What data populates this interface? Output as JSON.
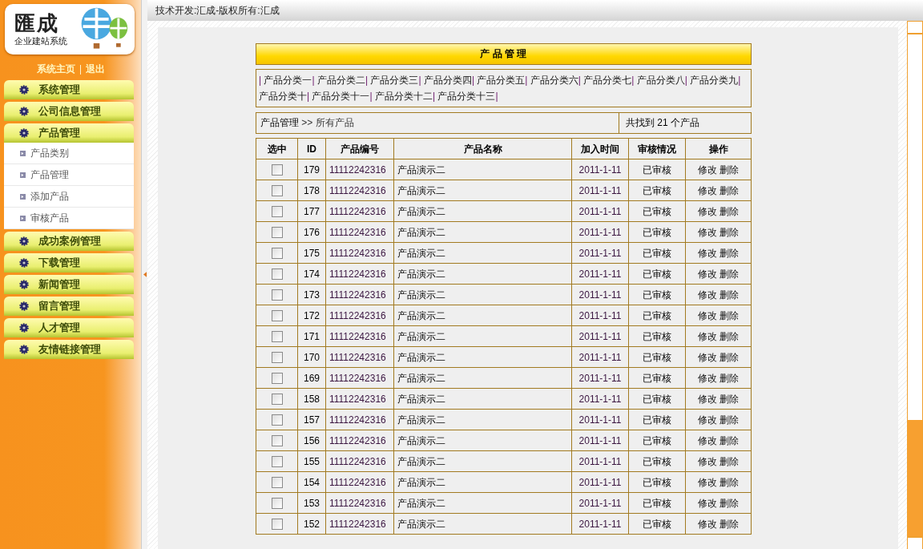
{
  "logo": {
    "title": "匯成",
    "subtitle": "企业建站系统"
  },
  "top_links": [
    "系统主页",
    "退出"
  ],
  "menu": [
    {
      "label": "系统管理",
      "expanded": false
    },
    {
      "label": "公司信息管理",
      "expanded": false
    },
    {
      "label": "产品管理",
      "expanded": true,
      "children": [
        {
          "label": "产品类别"
        },
        {
          "label": "产品管理"
        },
        {
          "label": "添加产品"
        },
        {
          "label": "审核产品"
        }
      ]
    },
    {
      "label": "成功案例管理",
      "expanded": false
    },
    {
      "label": "下载管理",
      "expanded": false
    },
    {
      "label": "新闻管理",
      "expanded": false
    },
    {
      "label": "留言管理",
      "expanded": false
    },
    {
      "label": "人才管理",
      "expanded": false
    },
    {
      "label": "友情链接管理",
      "expanded": false
    }
  ],
  "top_bar": "技术开发:汇成-版权所有:汇成",
  "panel_title": "产 品 管 理",
  "category_separator": "|",
  "categories": [
    "产品分类一",
    "产品分类二",
    "产品分类三",
    "产品分类四",
    "产品分类五",
    "产品分类六",
    "产品分类七",
    "产品分类八",
    "产品分类九",
    "产品分类十",
    "产品分类十一",
    "产品分类十二",
    "产品分类十三"
  ],
  "breadcrumb": {
    "section": "产品管理",
    "current": ">> 所有产品"
  },
  "found": {
    "prefix": "共找到",
    "count": "21",
    "suffix": "个产品"
  },
  "table": {
    "columns": [
      "选中",
      "ID",
      "产品编号",
      "产品名称",
      "加入时间",
      "审核情况",
      "操作"
    ],
    "rows": [
      {
        "checked": false,
        "id": "179",
        "code": "11112242316",
        "name": "产品演示二",
        "date": "2011-1-11",
        "status": "已审核",
        "edit": "修改",
        "delete": "删除"
      },
      {
        "checked": false,
        "id": "178",
        "code": "11112242316",
        "name": "产品演示二",
        "date": "2011-1-11",
        "status": "已审核",
        "edit": "修改",
        "delete": "删除"
      },
      {
        "checked": false,
        "id": "177",
        "code": "11112242316",
        "name": "产品演示二",
        "date": "2011-1-11",
        "status": "已审核",
        "edit": "修改",
        "delete": "删除"
      },
      {
        "checked": false,
        "id": "176",
        "code": "11112242316",
        "name": "产品演示二",
        "date": "2011-1-11",
        "status": "已审核",
        "edit": "修改",
        "delete": "删除"
      },
      {
        "checked": false,
        "id": "175",
        "code": "11112242316",
        "name": "产品演示二",
        "date": "2011-1-11",
        "status": "已审核",
        "edit": "修改",
        "delete": "删除"
      },
      {
        "checked": false,
        "id": "174",
        "code": "11112242316",
        "name": "产品演示二",
        "date": "2011-1-11",
        "status": "已审核",
        "edit": "修改",
        "delete": "删除"
      },
      {
        "checked": false,
        "id": "173",
        "code": "11112242316",
        "name": "产品演示二",
        "date": "2011-1-11",
        "status": "已审核",
        "edit": "修改",
        "delete": "删除"
      },
      {
        "checked": false,
        "id": "172",
        "code": "11112242316",
        "name": "产品演示二",
        "date": "2011-1-11",
        "status": "已审核",
        "edit": "修改",
        "delete": "删除"
      },
      {
        "checked": false,
        "id": "171",
        "code": "11112242316",
        "name": "产品演示二",
        "date": "2011-1-11",
        "status": "已审核",
        "edit": "修改",
        "delete": "删除"
      },
      {
        "checked": false,
        "id": "170",
        "code": "11112242316",
        "name": "产品演示二",
        "date": "2011-1-11",
        "status": "已审核",
        "edit": "修改",
        "delete": "删除"
      },
      {
        "checked": false,
        "id": "169",
        "code": "11112242316",
        "name": "产品演示二",
        "date": "2011-1-11",
        "status": "已审核",
        "edit": "修改",
        "delete": "删除"
      },
      {
        "checked": false,
        "id": "158",
        "code": "11112242316",
        "name": "产品演示二",
        "date": "2011-1-11",
        "status": "已审核",
        "edit": "修改",
        "delete": "删除"
      },
      {
        "checked": false,
        "id": "157",
        "code": "11112242316",
        "name": "产品演示二",
        "date": "2011-1-11",
        "status": "已审核",
        "edit": "修改",
        "delete": "删除"
      },
      {
        "checked": false,
        "id": "156",
        "code": "11112242316",
        "name": "产品演示二",
        "date": "2011-1-11",
        "status": "已审核",
        "edit": "修改",
        "delete": "删除"
      },
      {
        "checked": false,
        "id": "155",
        "code": "11112242316",
        "name": "产品演示二",
        "date": "2011-1-11",
        "status": "已审核",
        "edit": "修改",
        "delete": "删除"
      },
      {
        "checked": false,
        "id": "154",
        "code": "11112242316",
        "name": "产品演示二",
        "date": "2011-1-11",
        "status": "已审核",
        "edit": "修改",
        "delete": "删除"
      },
      {
        "checked": false,
        "id": "153",
        "code": "11112242316",
        "name": "产品演示二",
        "date": "2011-1-11",
        "status": "已审核",
        "edit": "修改",
        "delete": "删除"
      },
      {
        "checked": false,
        "id": "152",
        "code": "11112242316",
        "name": "产品演示二",
        "date": "2011-1-11",
        "status": "已审核",
        "edit": "修改",
        "delete": "删除"
      }
    ]
  }
}
